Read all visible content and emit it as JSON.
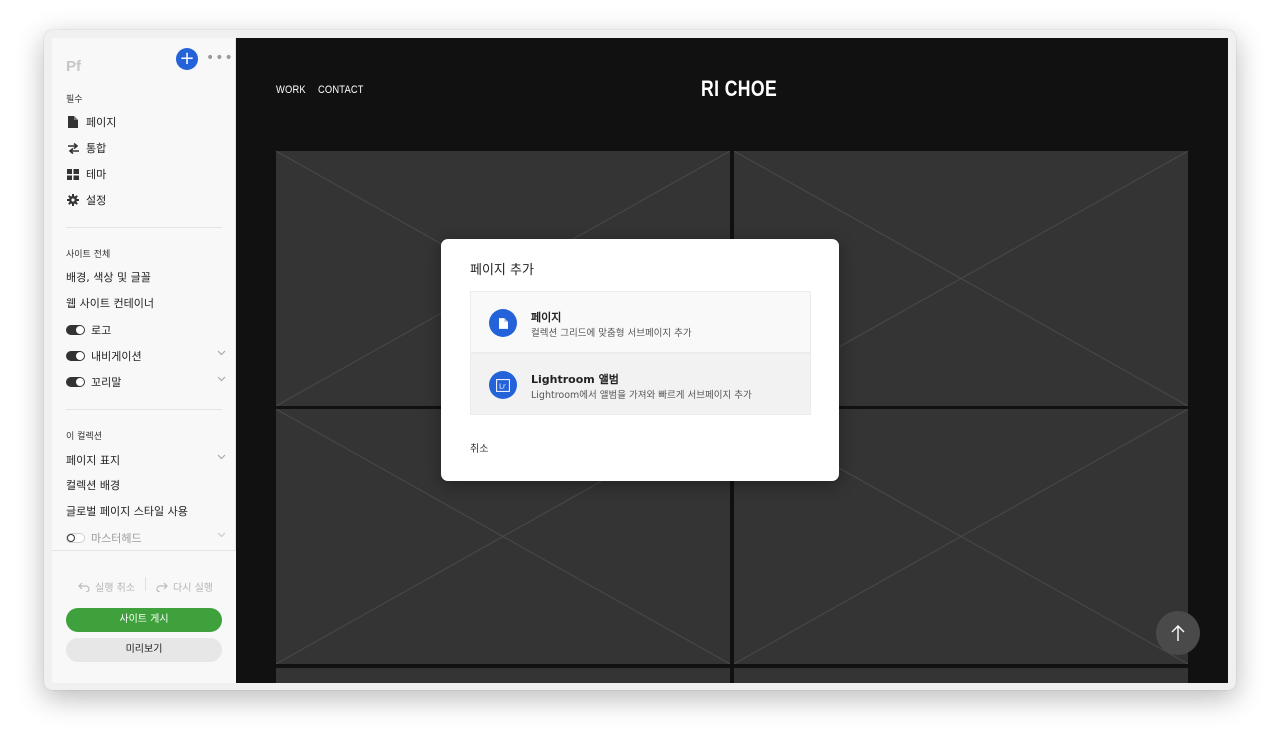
{
  "app": {
    "logo": "Pf",
    "add_label": "+",
    "more_label": "•••"
  },
  "sidebar": {
    "required_label": "필수",
    "required_items": [
      {
        "label": "페이지",
        "icon": "page-icon"
      },
      {
        "label": "통합",
        "icon": "integration-icon"
      },
      {
        "label": "테마",
        "icon": "theme-icon"
      },
      {
        "label": "설정",
        "icon": "gear-icon"
      }
    ],
    "site_wide_label": "사이트 전체",
    "site_items": {
      "background": "배경, 색상 및 글꼴",
      "container": "웹 사이트 컨테이너",
      "logo": "로고",
      "navigation": "내비게이션",
      "footer": "꼬리말"
    },
    "collection_label": "이 컬렉션",
    "collection_items": {
      "page_display": "페이지 표지",
      "collection_bg": "컬렉션 배경",
      "global_style": "글로벌 페이지 스타일 사용",
      "masthead": "마스터헤드"
    },
    "undo": "실행 취소",
    "redo": "다시 실행",
    "publish": "사이트 게시",
    "preview": "미리보기"
  },
  "site": {
    "nav": [
      "WORK",
      "CONTACT"
    ],
    "title": "RI CHOE"
  },
  "modal": {
    "title": "페이지 추가",
    "options": [
      {
        "title": "페이지",
        "desc": "컬렉션 그리드에 맞춤형 서브페이지 추가",
        "icon": "page-icon"
      },
      {
        "title": "Lightroom 앨범",
        "desc": "Lightroom에서 앨범을 가져와 빠르게 서브페이지 추가",
        "icon": "lightroom-icon"
      }
    ],
    "cancel": "취소"
  },
  "colors": {
    "accent": "#2362d8",
    "publish": "#3fa13c",
    "canvas": "#111111",
    "placeholder": "#343434"
  }
}
